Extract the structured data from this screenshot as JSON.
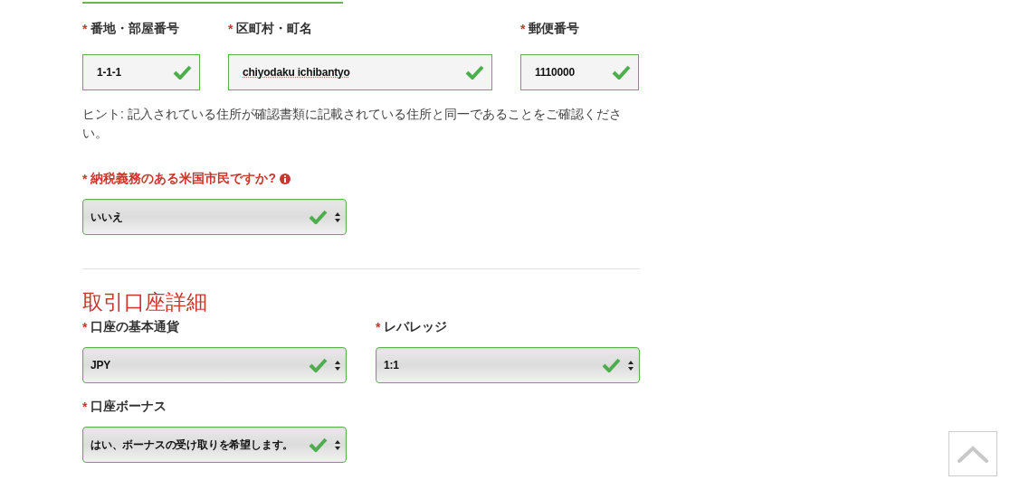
{
  "address_rows": [
    [
      {
        "mark": "*",
        "label": "番地・部屋番号",
        "kind": "text",
        "value": "1-1-1",
        "valid": true,
        "spellcheck_flag": false
      },
      {
        "mark": "*",
        "label": "区町村・町名",
        "kind": "text",
        "value": "chiyodaku ichibantyo",
        "valid": true,
        "spellcheck_flag": true
      },
      {
        "mark": "*",
        "label": "郵便番号",
        "kind": "text",
        "value": "1110000",
        "valid": true,
        "spellcheck_flag": false
      }
    ]
  ],
  "hint": "ヒント: 記入されている住所が確認書類に記載されている住所と同一であることをご確認ください。",
  "tax_question": {
    "mark": "*",
    "label": "納税義務のある米国市民ですか?",
    "alert": true,
    "info": true,
    "kind": "select",
    "value": "いいえ",
    "valid": true
  },
  "section": {
    "title": "取引口座詳細",
    "fields": [
      {
        "mark": "*",
        "label": "口座の基本通貨",
        "kind": "select",
        "value": "JPY",
        "valid": true
      },
      {
        "mark": "*",
        "label": "レバレッジ",
        "kind": "select",
        "value": "1:1",
        "valid": true
      },
      {
        "mark": "*",
        "label": "口座ボーナス",
        "kind": "select",
        "value": "はい、ボーナスの受け取りを希望します。",
        "valid": true
      }
    ]
  },
  "scroll_top_button": true
}
